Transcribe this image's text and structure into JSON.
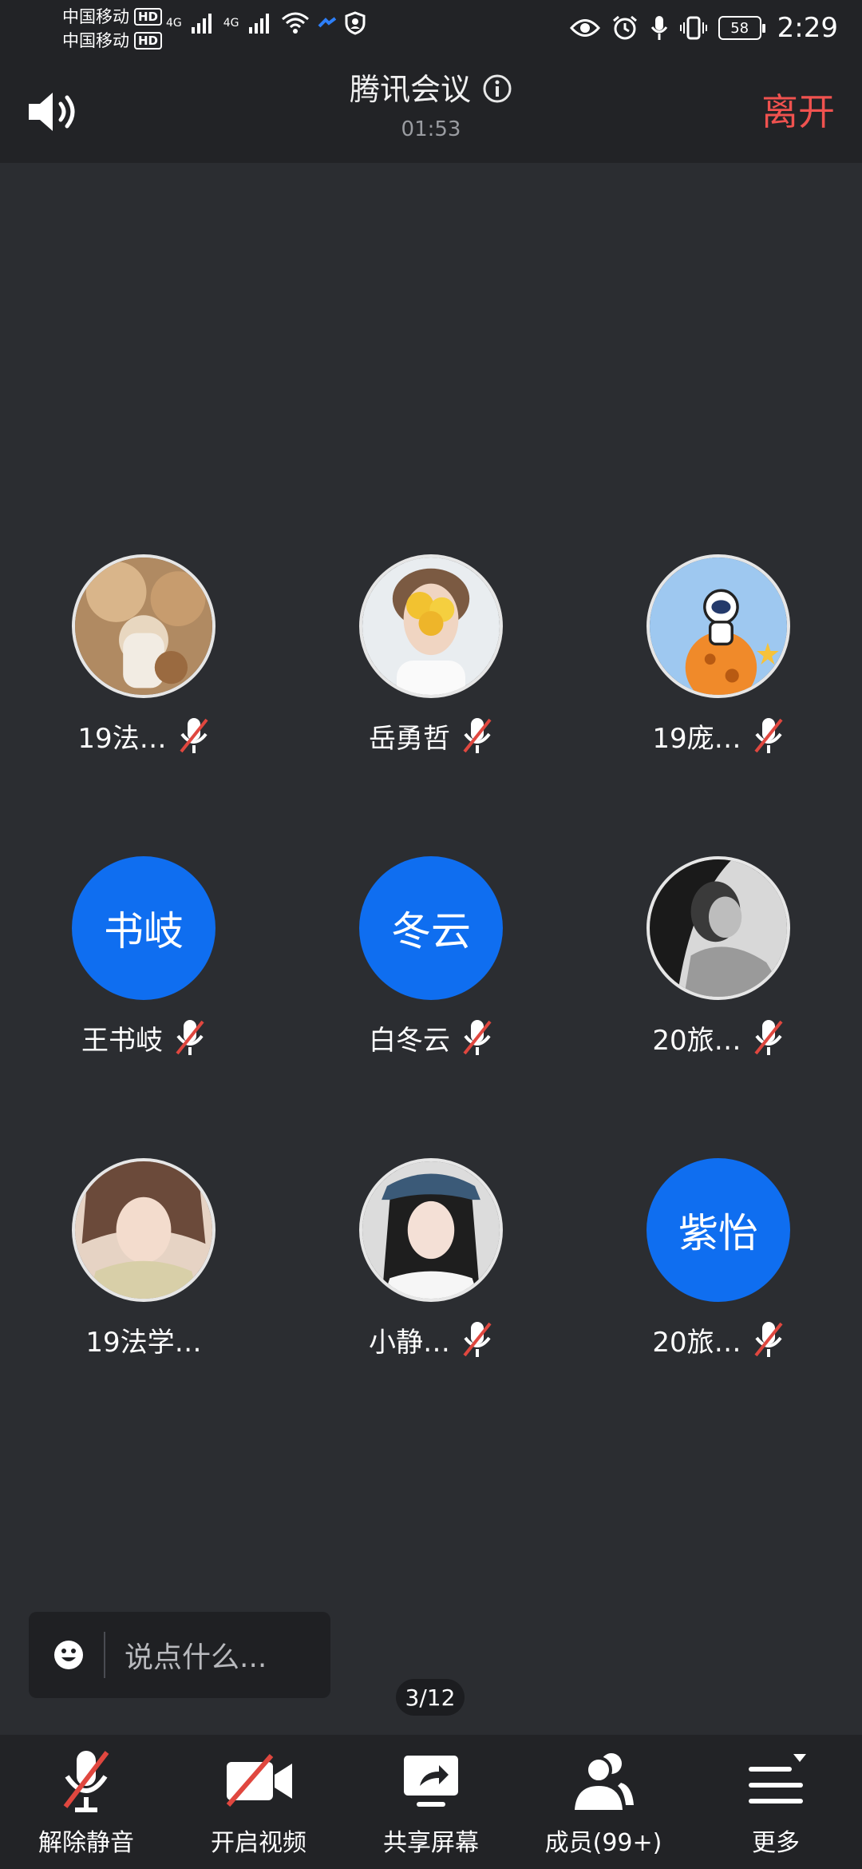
{
  "status_bar": {
    "carrier_1": "中国移动",
    "carrier_2": "中国移动",
    "hd_badge": "HD",
    "network": "4G",
    "battery": "58",
    "time": "2:29"
  },
  "header": {
    "title": "腾讯会议",
    "timer": "01:53",
    "leave_label": "离开"
  },
  "participants": [
    {
      "name": "19法…",
      "avatar_type": "photo"
    },
    {
      "name": "岳勇哲",
      "avatar_type": "photo"
    },
    {
      "name": "19庞…",
      "avatar_type": "photo"
    },
    {
      "name": "王书岐",
      "avatar_type": "text",
      "avatar_text": "书岐"
    },
    {
      "name": "白冬云",
      "avatar_type": "text",
      "avatar_text": "冬云"
    },
    {
      "name": "20旅…",
      "avatar_type": "photo"
    },
    {
      "name": "19法学…",
      "avatar_type": "photo"
    },
    {
      "name": "小静…",
      "avatar_type": "photo"
    },
    {
      "name": "20旅…",
      "avatar_type": "text",
      "avatar_text": "紫怡"
    }
  ],
  "chat": {
    "placeholder": "说点什么..."
  },
  "pager": "3/12",
  "toolbar": {
    "unmute": "解除静音",
    "start_video": "开启视频",
    "share_screen": "共享屏幕",
    "members": "成员(99+)",
    "more": "更多"
  },
  "colors": {
    "background": "#2b2d31",
    "bar": "#222326",
    "accent_blue": "#0f6ef0",
    "leave_red": "#f0524f",
    "mute_red": "#e0473f"
  }
}
